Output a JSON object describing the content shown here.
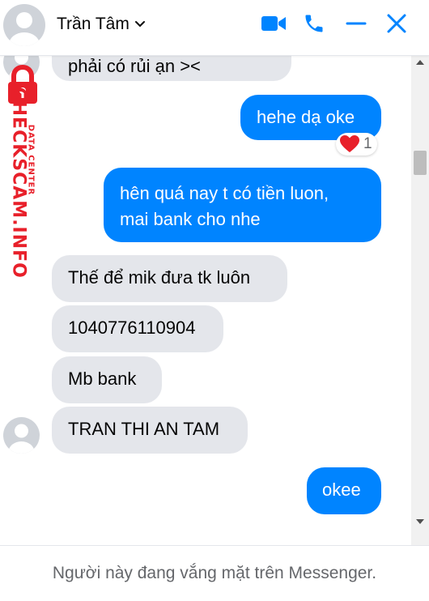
{
  "header": {
    "contact_name": "Trần Tâm",
    "icons": [
      "video-call-icon",
      "phone-call-icon",
      "minimize-icon",
      "close-icon",
      "chevron-down-icon"
    ],
    "accent_color": "#0084ff"
  },
  "watermark": {
    "brand": "CHECKSCAM.INFO",
    "tagline": "DATA CENTER",
    "color": "#e8202a"
  },
  "messages": [
    {
      "direction": "incoming",
      "text": "phải có rủi ạn ><"
    },
    {
      "direction": "outgoing",
      "text": "hehe dạ oke",
      "reaction": {
        "emoji": "heart",
        "count": "1"
      }
    },
    {
      "direction": "outgoing",
      "text": "hên quá nay t có tiền luon,\nmai bank cho nhe"
    },
    {
      "direction": "incoming",
      "text": "Thế để mik đưa tk luôn"
    },
    {
      "direction": "incoming",
      "text": "1040776110904"
    },
    {
      "direction": "incoming",
      "text": "Mb bank"
    },
    {
      "direction": "incoming",
      "text": "TRAN THI AN TAM"
    },
    {
      "direction": "outgoing",
      "text": "okee"
    }
  ],
  "footer": {
    "status_text": "Người này đang vắng mặt trên Messenger."
  },
  "colors": {
    "incoming_bubble": "#e4e6eb",
    "outgoing_bubble": "#0084ff"
  }
}
